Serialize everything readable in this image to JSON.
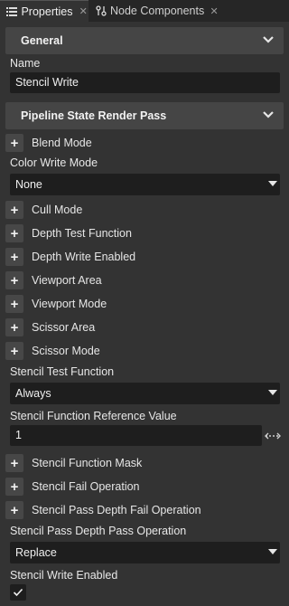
{
  "tabs": [
    {
      "label": "Properties",
      "icon": "list-icon",
      "active": true
    },
    {
      "label": "Node Components",
      "icon": "components-icon",
      "active": false
    }
  ],
  "general": {
    "title": "General",
    "name_label": "Name",
    "name_value": "Stencil Write"
  },
  "pipeline": {
    "title": "Pipeline State Render Pass",
    "blend_mode": "Blend Mode",
    "color_write_mode_label": "Color Write Mode",
    "color_write_mode_value": "None",
    "cull_mode": "Cull Mode",
    "depth_test_function": "Depth Test Function",
    "depth_write_enabled": "Depth Write Enabled",
    "viewport_area": "Viewport Area",
    "viewport_mode": "Viewport Mode",
    "scissor_area": "Scissor Area",
    "scissor_mode": "Scissor Mode",
    "stencil_test_function_label": "Stencil Test Function",
    "stencil_test_function_value": "Always",
    "stencil_ref_label": "Stencil Function Reference Value",
    "stencil_ref_value": "1",
    "stencil_function_mask": "Stencil Function Mask",
    "stencil_fail_operation": "Stencil Fail Operation",
    "stencil_pass_depth_fail_operation": "Stencil Pass Depth Fail Operation",
    "stencil_pass_depth_pass_label": "Stencil Pass Depth Pass Operation",
    "stencil_pass_depth_pass_value": "Replace",
    "stencil_write_enabled_label": "Stencil Write Enabled",
    "stencil_write_enabled_checked": true
  },
  "colors": {
    "panel_bg": "#333333",
    "field_bg": "#1e1e1e",
    "section_bg": "#454545",
    "tabbar_bg": "#262626"
  }
}
